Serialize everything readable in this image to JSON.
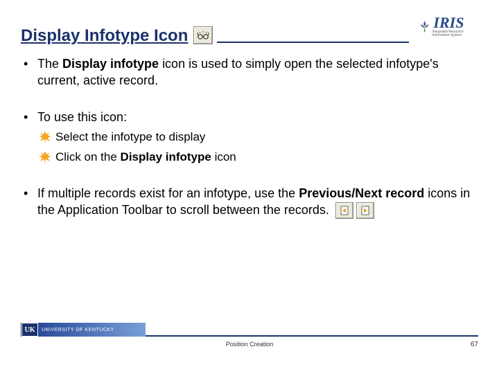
{
  "header": {
    "title": "Display Infotype Icon",
    "logo_text": "IRIS",
    "logo_sub": "Integrated Resource Information System",
    "display_icon_name": "glasses-icon"
  },
  "bullets": {
    "b1_pre": "The ",
    "b1_bold": "Display infotype ",
    "b1_post": "icon is used to simply open the selected infotype's current, active record.",
    "b2": "To use this icon:",
    "b2_sub1": "Select the infotype to display",
    "b2_sub2_pre": "Click on the ",
    "b2_sub2_bold": "Display infotype ",
    "b2_sub2_post": "icon",
    "b3_pre": "If multiple records exist for an infotype, use the ",
    "b3_bold": "Previous/Next record ",
    "b3_post": "icons in the Application Toolbar to scroll between the records."
  },
  "footer": {
    "org": "UNIVERSITY OF KENTUCKY",
    "mark": "UK",
    "center": "Position Creation",
    "page": "67"
  },
  "icons": {
    "prev": "prev-record-icon",
    "next": "next-record-icon"
  }
}
